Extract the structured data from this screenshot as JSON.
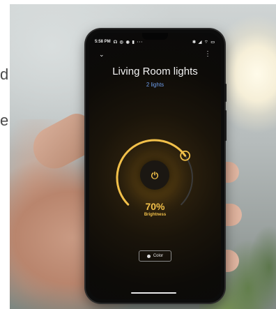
{
  "left_fragments": [
    "d",
    "e"
  ],
  "phone": {
    "status_time": "5:58 PM",
    "status_left_icons": "☊ ◎ ◉ ▮ ···",
    "status_right_icons": "✱ ◢ ⌔ ▭",
    "chevron_icon": "chevron-down-icon",
    "menu_icon": "more-vert-icon",
    "title": "Living Room lights",
    "subtitle": "2 lights",
    "brightness_value": "70%",
    "brightness_level": 0.7,
    "brightness_label": "Brightness",
    "color_button_label": "Color",
    "accent_color": "#f2c04a",
    "link_color": "#6d9be8"
  }
}
